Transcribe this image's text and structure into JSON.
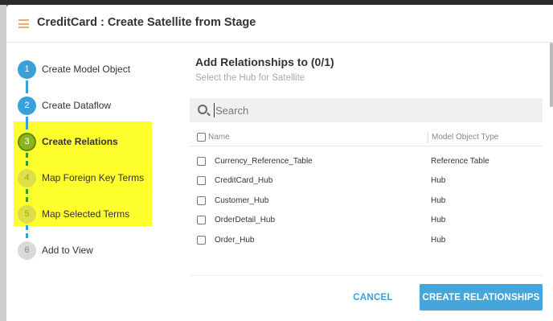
{
  "dialog": {
    "title": "CreditCard : Create Satellite from Stage"
  },
  "steps": [
    {
      "number": "1",
      "label": "Create Model Object",
      "state": "done"
    },
    {
      "number": "2",
      "label": "Create Dataflow",
      "state": "done"
    },
    {
      "number": "3",
      "label": "Create Relations",
      "state": "active"
    },
    {
      "number": "4",
      "label": "Map Foreign Key Terms",
      "state": "todo"
    },
    {
      "number": "5",
      "label": "Map Selected Terms",
      "state": "todo"
    },
    {
      "number": "6",
      "label": "Add to View",
      "state": "todo"
    }
  ],
  "main": {
    "title": "Add Relationships to (0/1)",
    "subtitle": "Select the Hub for Satellite",
    "search": {
      "placeholder": "Search",
      "value": ""
    },
    "columns": {
      "name": "Name",
      "type": "Model Object Type"
    },
    "rows": [
      {
        "name": "Currency_Reference_Table",
        "type": "Reference Table",
        "checked": false
      },
      {
        "name": "CreditCard_Hub",
        "type": "Hub",
        "checked": false
      },
      {
        "name": "Customer_Hub",
        "type": "Hub",
        "checked": false
      },
      {
        "name": "OrderDetail_Hub",
        "type": "Hub",
        "checked": false
      },
      {
        "name": "Order_Hub",
        "type": "Hub",
        "checked": false
      }
    ]
  },
  "buttons": {
    "cancel": "CANCEL",
    "create": "CREATE RELATIONSHIPS"
  },
  "colors": {
    "accent": "#44a6db",
    "highlight": "#ffff2e",
    "menu_icon": "#f2a96a"
  },
  "icons": [
    "menu-icon",
    "search-icon"
  ]
}
